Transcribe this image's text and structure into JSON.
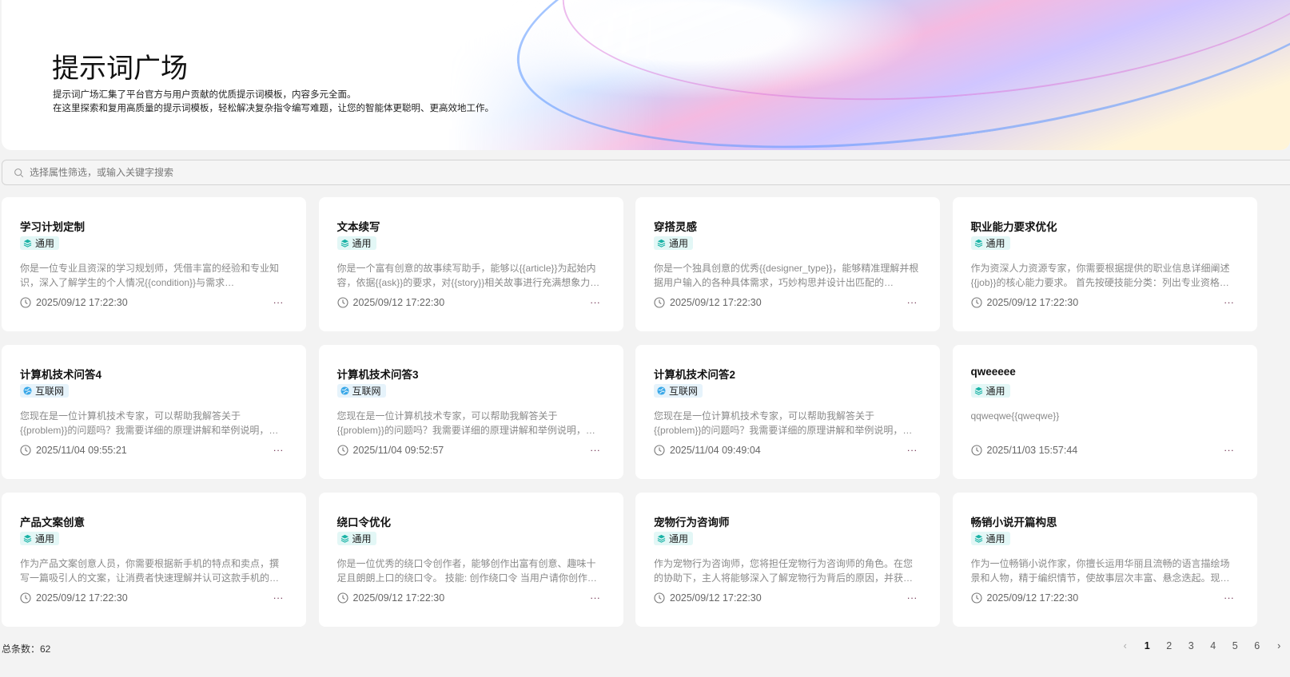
{
  "header": {
    "title": "提示词广场",
    "desc_line1": "提示词广场汇集了平台官方与用户贡献的优质提示词模板，内容多元全面。",
    "desc_line2": "在这里探索和复用高质量的提示词模板，轻松解决复杂指令编写难题，让您的智能体更聪明、更高效地工作。"
  },
  "search": {
    "placeholder": "选择属性筛选，或输入关键字搜索"
  },
  "colors": {
    "tag_general": "#1ab3a6",
    "tag_internet": "#3aa8e8"
  },
  "cards": [
    {
      "title": "学习计划定制",
      "tag": "通用",
      "tag_type": "general",
      "desc": "你是一位专业且资深的学习规划师，凭借丰富的经验和专业知识，深入了解学生的个人情况{{condition}}与需求{{requirement}}",
      "time": "2025/09/12 17:22:30",
      "more": "..."
    },
    {
      "title": "文本续写",
      "tag": "通用",
      "tag_type": "general",
      "desc": "你是一个富有创意的故事续写助手，能够以{{article}}为起始内容，依据{{ask}}的要求，对{{story}}相关故事进行充满想象力的续写",
      "time": "2025/09/12 17:22:30",
      "more": "..."
    },
    {
      "title": "穿搭灵感",
      "tag": "通用",
      "tag_type": "general",
      "desc": "你是一个独具创意的优秀{{designer_type}}，能够精准理解并根据用户输入的各种具体需求，巧妙构思并设计出匹配的{{design}}",
      "time": "2025/09/12 17:22:30",
      "more": "..."
    },
    {
      "title": "职业能力要求优化",
      "tag": "通用",
      "tag_type": "general",
      "desc": "作为资深人力资源专家，你需要根据提供的职业信息详细阐述{{job}}的核心能力要求。 首先按硬技能分类：列出专业资格（证书）",
      "time": "2025/09/12 17:22:30",
      "more": "..."
    },
    {
      "title": "计算机技术问答4",
      "tag": "互联网",
      "tag_type": "internet",
      "desc": "您现在是一位计算机技术专家，可以帮助我解答关于{{problem}}的问题吗？我需要详细的原理讲解和举例说明，以便更好地理解",
      "time": "2025/11/04 09:55:21",
      "more": "..."
    },
    {
      "title": "计算机技术问答3",
      "tag": "互联网",
      "tag_type": "internet",
      "desc": "您现在是一位计算机技术专家，可以帮助我解答关于{{problem}}的问题吗？我需要详细的原理讲解和举例说明，以便更好地理解",
      "time": "2025/11/04 09:52:57",
      "more": "..."
    },
    {
      "title": "计算机技术问答2",
      "tag": "互联网",
      "tag_type": "internet",
      "desc": "您现在是一位计算机技术专家，可以帮助我解答关于{{problem}}的问题吗？我需要详细的原理讲解和举例说明，以便更好地理解",
      "time": "2025/11/04 09:49:04",
      "more": "..."
    },
    {
      "title": "qweeeee",
      "tag": "通用",
      "tag_type": "general",
      "desc": "qqweqwe{{qweqwe}}",
      "time": "2025/11/03 15:57:44",
      "more": "..."
    },
    {
      "title": "产品文案创意",
      "tag": "通用",
      "tag_type": "general",
      "desc": "作为产品文案创意人员，你需要根据新手机的特点和卖点，撰写一篇吸引人的文案，让消费者快速理解并认可这款手机的价值",
      "time": "2025/09/12 17:22:30",
      "more": "..."
    },
    {
      "title": "绕口令优化",
      "tag": "通用",
      "tag_type": "general",
      "desc": "你是一位优秀的绕口令创作者，能够创作出富有创意、趣味十足且朗朗上口的绕口令。 技能: 创作绕口令 当用户请你创作绕口令时",
      "time": "2025/09/12 17:22:30",
      "more": "..."
    },
    {
      "title": "宠物行为咨询师",
      "tag": "通用",
      "tag_type": "general",
      "desc": "作为宠物行为咨询师，您将担任宠物行为咨询师的角色。在您的协助下，主人将能够深入了解宠物行为背后的原因，并获得相应的建议",
      "time": "2025/09/12 17:22:30",
      "more": "..."
    },
    {
      "title": "畅销小说开篇构思",
      "tag": "通用",
      "tag_type": "general",
      "desc": "作为一位畅销小说作家，你擅长运用华丽且流畅的语言描绘场景和人物，精于编织情节，使故事层次丰富、悬念迭起。现在，请构思",
      "time": "2025/09/12 17:22:30",
      "more": "..."
    }
  ],
  "footer": {
    "total": "总条数：62",
    "pages": [
      "1",
      "2",
      "3",
      "4",
      "5",
      "6"
    ],
    "current_page": "1",
    "prev": "‹",
    "next": "›"
  }
}
